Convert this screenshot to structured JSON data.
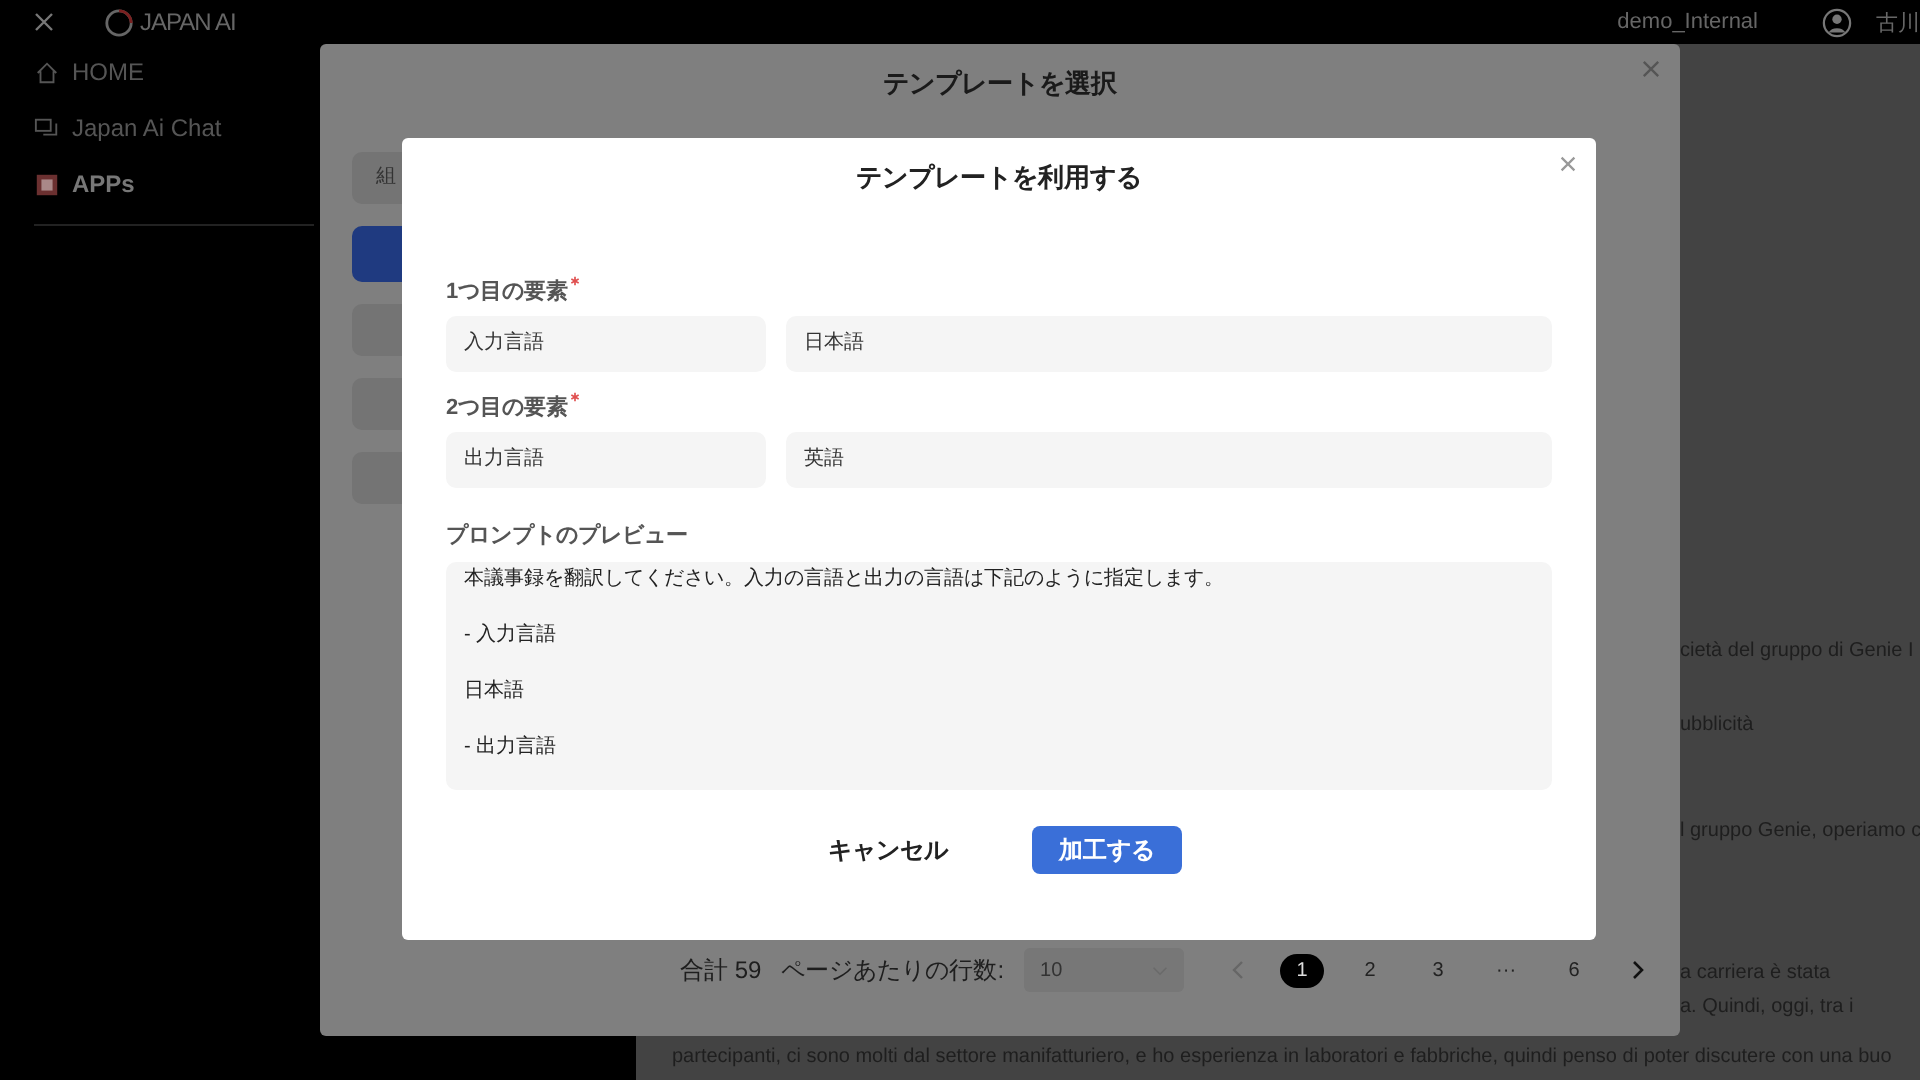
{
  "topbar": {
    "logo": "JAPAN AI",
    "workspace": "demo_Internal",
    "user": "古川"
  },
  "sidebar": {
    "items": [
      {
        "label": "HOME",
        "kind": "home",
        "selected": false
      },
      {
        "label": "Japan Ai Chat",
        "kind": "chat",
        "selected": false
      },
      {
        "label": "APPs",
        "kind": "apps",
        "selected": true
      }
    ]
  },
  "background_text": [
    "cietà del gruppo di Genie I",
    "ubblicità",
    "l gruppo Genie, operiamo c",
    "a carriera è stata",
    "a. Quindi, oggi, tra i"
  ],
  "background_bottom_line": "partecipanti, ci sono molti dal settore manifatturiero, e ho esperienza in laboratori e fabbriche, quindi penso di poter discutere con una buo",
  "select_dialog": {
    "title": "テンプレートを選択",
    "categories": [
      {
        "label": "組",
        "selected": false
      },
      {
        "selected": true
      },
      {
        "selected": false
      },
      {
        "selected": false
      },
      {
        "selected": false
      }
    ],
    "pagination": {
      "total": "合計 59",
      "rows_label": "ページあたりの行数:",
      "rows_value": "10",
      "pages": [
        {
          "label": "1",
          "selected": true
        },
        {
          "label": "2",
          "selected": false
        },
        {
          "label": "3",
          "selected": false
        },
        {
          "label": "···",
          "selected": false
        },
        {
          "label": "6",
          "selected": false
        }
      ]
    }
  },
  "use_dialog": {
    "title": "テンプレートを利用する",
    "elements": [
      {
        "label": "1つ目の要素",
        "required": true,
        "name": "入力言語",
        "value": "日本語"
      },
      {
        "label": "2つ目の要素",
        "required": true,
        "name": "出力言語",
        "value": "英語"
      }
    ],
    "preview_label": "プロンプトのプレビュー",
    "preview_lines": [
      "本議事録を翻訳してください。入力の言語と出力の言語は下記のように指定します。",
      "- 入力言語",
      "日本語",
      "- 出力言語"
    ],
    "cancel": "キャンセル",
    "submit": "加工する"
  }
}
